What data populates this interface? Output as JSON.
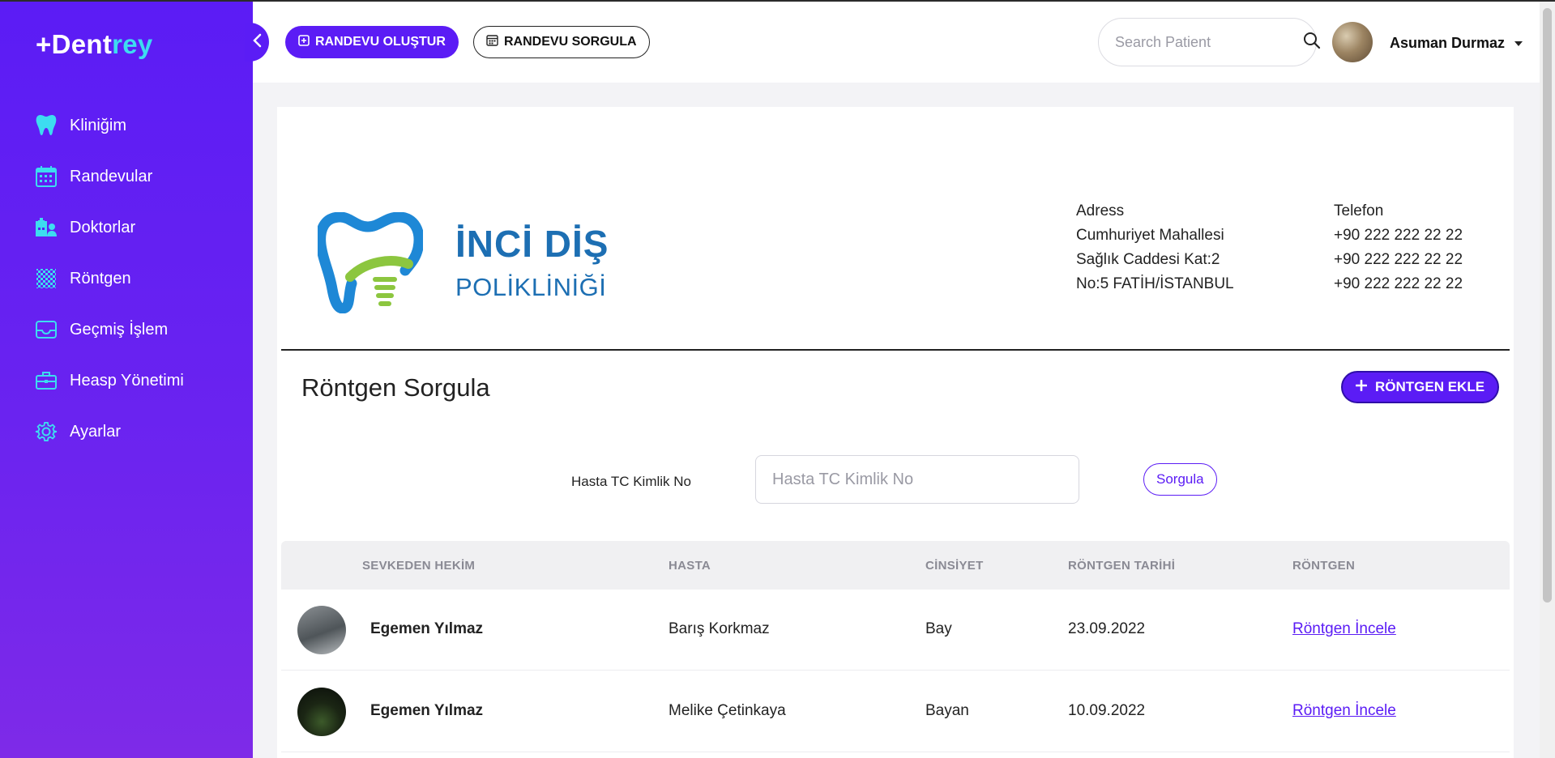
{
  "brand": {
    "prefix": "+Dent",
    "accent": "rey"
  },
  "sidebar": {
    "items": [
      {
        "label": "Kliniğim",
        "icon": "tooth-icon"
      },
      {
        "label": "Randevular",
        "icon": "calendar-icon"
      },
      {
        "label": "Doktorlar",
        "icon": "hospital-user-icon"
      },
      {
        "label": "Röntgen",
        "icon": "checkerboard-icon"
      },
      {
        "label": "Geçmiş İşlem",
        "icon": "inbox-icon"
      },
      {
        "label": "Heasp Yönetimi",
        "icon": "briefcase-icon"
      },
      {
        "label": "Ayarlar",
        "icon": "gear-icon"
      }
    ]
  },
  "topbar": {
    "create_appointment": "RANDEVU OLUŞTUR",
    "query_appointment": "RANDEVU SORGULA",
    "search_placeholder": "Search Patient",
    "user_name": "Asuman Durmaz"
  },
  "clinic": {
    "name_line1": "İNCİ DİŞ",
    "name_line2": "POLİKLİNİĞİ",
    "address_label": "Adress",
    "address_lines": [
      "Cumhuriyet Mahallesi",
      "Sağlık Caddesi Kat:2",
      "No:5 FATİH/İSTANBUL"
    ],
    "phone_label": "Telefon",
    "phones": [
      "+90 222 222 22 22",
      "+90 222 222 22 22",
      "+90 222 222 22 22"
    ]
  },
  "page": {
    "title": "Röntgen Sorgula",
    "add_button": "RÖNTGEN EKLE",
    "tc_label": "Hasta TC Kimlik No",
    "tc_placeholder": "Hasta TC Kimlik No",
    "query_button": "Sorgula"
  },
  "table": {
    "headers": [
      "SEVKEDEN HEKİM",
      "HASTA",
      "CİNSİYET",
      "RÖNTGEN TARİHİ",
      "RÖNTGEN"
    ],
    "rows": [
      {
        "doctor": "Egemen Yılmaz",
        "patient": "Barış Korkmaz",
        "gender": "Bay",
        "date": "23.09.2022",
        "xray": "Röntgen İncele"
      },
      {
        "doctor": "Egemen Yılmaz",
        "patient": "Melike Çetinkaya",
        "gender": "Bayan",
        "date": "10.09.2022",
        "xray": "Röntgen İncele"
      }
    ]
  },
  "colors": {
    "primary": "#5b1cf5",
    "accent": "#3ddcf0",
    "clinic_blue": "#1d6fb3",
    "clinic_green": "#8cc63f"
  }
}
